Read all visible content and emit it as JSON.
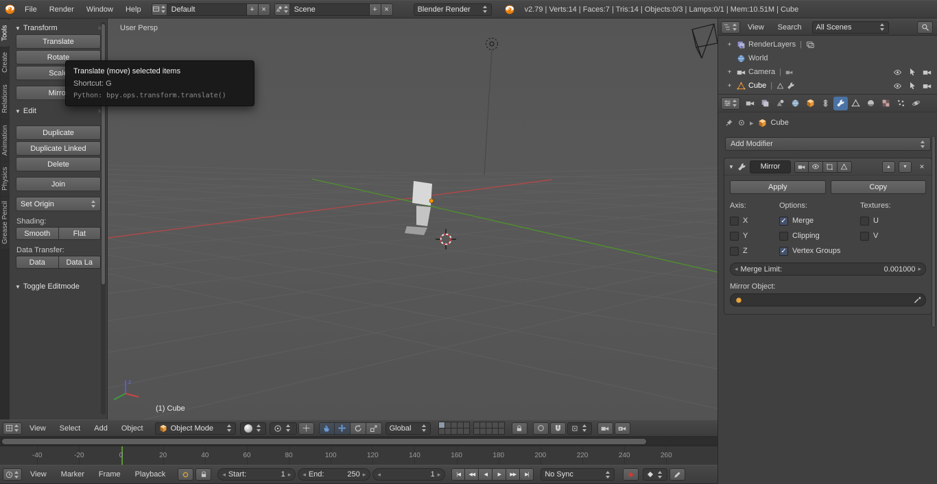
{
  "topbar": {
    "menus": [
      "File",
      "Render",
      "Window",
      "Help"
    ],
    "screen_value": "Default",
    "scene_value": "Scene",
    "engine_value": "Blender Render",
    "stats": "v2.79 | Verts:14 | Faces:7 | Tris:14 | Objects:0/3 | Lamps:0/1 | Mem:10.51M | Cube"
  },
  "tool_tabs": {
    "items": [
      "Tools",
      "Create",
      "Relations",
      "Animation",
      "Physics",
      "Grease Pencil"
    ]
  },
  "tool_shelf": {
    "transform_title": "Transform",
    "translate": "Translate",
    "rotate": "Rotate",
    "scale": "Scale",
    "mirror": "Mirror",
    "edit_title": "Edit",
    "duplicate": "Duplicate",
    "duplicate_linked": "Duplicate Linked",
    "delete": "Delete",
    "join": "Join",
    "set_origin": "Set Origin",
    "shading_label": "Shading:",
    "smooth": "Smooth",
    "flat": "Flat",
    "data_transfer_label": "Data Transfer:",
    "data": "Data",
    "data_la": "Data La",
    "toggle_editmode": "Toggle Editmode"
  },
  "tooltip": {
    "title": "Translate (move) selected items",
    "shortcut": "Shortcut: G",
    "python": "Python: bpy.ops.transform.translate()"
  },
  "viewport": {
    "view_label": "User Persp",
    "object_label": "(1) Cube",
    "axis_z_label": "z"
  },
  "viewport_header": {
    "menus": [
      "View",
      "Select",
      "Add",
      "Object"
    ],
    "mode_value": "Object Mode",
    "orientation_value": "Global"
  },
  "timeline": {
    "ticks": [
      "-40",
      "-20",
      "0",
      "20",
      "40",
      "60",
      "80",
      "100",
      "120",
      "140",
      "160",
      "180",
      "200",
      "220",
      "240",
      "260"
    ],
    "menus": [
      "View",
      "Marker",
      "Frame",
      "Playback"
    ],
    "start_label": "Start:",
    "start_value": "1",
    "end_label": "End:",
    "end_value": "250",
    "frame_value": "1",
    "playback": [
      "|◀",
      "◀◀",
      "◀",
      "▶",
      "▶▶",
      "▶|"
    ],
    "sync_value": "No Sync"
  },
  "outliner": {
    "menus": [
      "View",
      "Search"
    ],
    "filter_value": "All Scenes",
    "items": [
      {
        "label": "RenderLayers"
      },
      {
        "label": "World"
      },
      {
        "label": "Camera"
      },
      {
        "label": "Cube"
      }
    ]
  },
  "properties": {
    "breadcrumb_object": "Cube",
    "add_modifier": "Add Modifier",
    "modifier": {
      "name": "Mirror",
      "apply": "Apply",
      "copy": "Copy",
      "axis_label": "Axis:",
      "options_label": "Options:",
      "textures_label": "Textures:",
      "axis": [
        {
          "label": "X",
          "checked": false
        },
        {
          "label": "Y",
          "checked": false
        },
        {
          "label": "Z",
          "checked": false
        }
      ],
      "options": [
        {
          "label": "Merge",
          "checked": true
        },
        {
          "label": "Clipping",
          "checked": false
        },
        {
          "label": "Vertex Groups",
          "checked": true
        }
      ],
      "textures": [
        {
          "label": "U",
          "checked": false
        },
        {
          "label": "V",
          "checked": false
        }
      ],
      "merge_limit_label": "Merge Limit:",
      "merge_limit_value": "0.001000",
      "mirror_object_label": "Mirror Object:"
    }
  },
  "glyphs": {
    "collapse": "▼",
    "plus": "+",
    "close": "×",
    "check": "✓",
    "left": "◂",
    "right": "▸",
    "up": "▲",
    "down": "▼",
    "pipe": "|",
    "grip": "≡",
    "bcrumb": "▸"
  }
}
